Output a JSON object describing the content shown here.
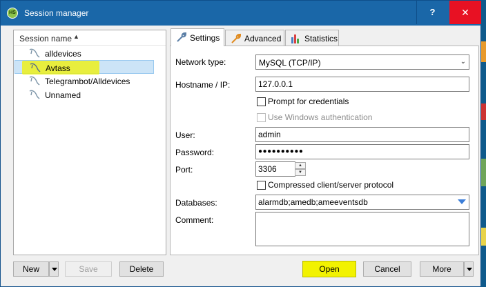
{
  "window": {
    "title": "Session manager",
    "app_icon_text": "HS",
    "help_label": "?",
    "close_label": "✕"
  },
  "sessions": {
    "header_label": "Session name",
    "sort_indicator": "▲",
    "items": [
      {
        "name": "alldevices",
        "selected": false
      },
      {
        "name": "Avtass",
        "selected": true
      },
      {
        "name": "Telegrambot/Alldevices",
        "selected": false
      },
      {
        "name": "Unnamed",
        "selected": false
      }
    ]
  },
  "tabs": [
    {
      "label": "Settings",
      "icon": "wrench-icon",
      "active": true
    },
    {
      "label": "Advanced",
      "icon": "wrench-orange-icon",
      "active": false
    },
    {
      "label": "Statistics",
      "icon": "bar-chart-icon",
      "active": false
    }
  ],
  "settings": {
    "network_type_label": "Network type:",
    "network_type_value": "MySQL (TCP/IP)",
    "hostname_label": "Hostname / IP:",
    "hostname_value": "127.0.0.1",
    "prompt_credentials_label": "Prompt for credentials",
    "prompt_credentials_checked": false,
    "windows_auth_label": "Use Windows authentication",
    "windows_auth_checked": false,
    "windows_auth_enabled": false,
    "user_label": "User:",
    "user_value": "admin",
    "password_label": "Password:",
    "password_value": "●●●●●●●●●●",
    "port_label": "Port:",
    "port_value": "3306",
    "compressed_label": "Compressed client/server protocol",
    "compressed_checked": false,
    "databases_label": "Databases:",
    "databases_value": "alarmdb;amedb;ameeventsdb",
    "comment_label": "Comment:",
    "comment_value": ""
  },
  "buttons": {
    "new_label": "New",
    "save_label": "Save",
    "delete_label": "Delete",
    "open_label": "Open",
    "cancel_label": "Cancel",
    "more_label": "More"
  },
  "colors": {
    "titlebar": "#1a67a8",
    "close": "#e81123",
    "highlight": "#f2f200",
    "selection": "#cce4f7"
  }
}
